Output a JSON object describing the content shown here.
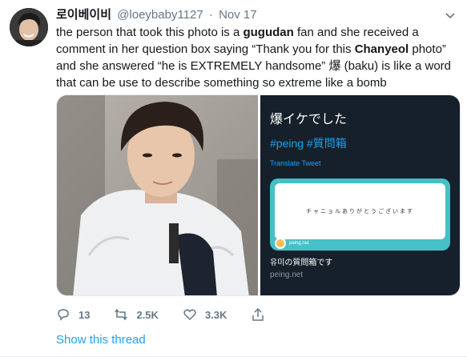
{
  "tweet": {
    "display_name": "로이베이비",
    "handle": "@loeybaby1127",
    "separator": "·",
    "date": "Nov 17",
    "text_parts": {
      "p1": "the person that took this photo is a ",
      "b1": "gugudan",
      "p2": " fan and she received a comment in her question box saying “Thank you for this ",
      "b2": "Chanyeol",
      "p3": " photo” and she answered “he is EXTREMELY handsome” 爆 (baku) is like a word that can be use to describe something so extreme like a bomb"
    },
    "embedded": {
      "title": "爆イケでした",
      "tags": "#peing #質問箱",
      "translate": "Translate Tweet",
      "card_message": "チャニョルありがとうございます",
      "card_brand": "peing.net",
      "card_title": "유미の質問箱です",
      "card_url": "peing.net"
    },
    "actions": {
      "replies": "13",
      "retweets": "2.5K",
      "likes": "3.3K"
    },
    "show_thread": "Show this thread"
  },
  "colors": {
    "accent": "#1da1f2",
    "muted": "#657786",
    "dark_panel": "#15202b",
    "card_teal": "#45c0c7"
  },
  "icons": [
    "chevron-down-icon",
    "reply-icon",
    "retweet-icon",
    "like-icon",
    "share-icon"
  ]
}
